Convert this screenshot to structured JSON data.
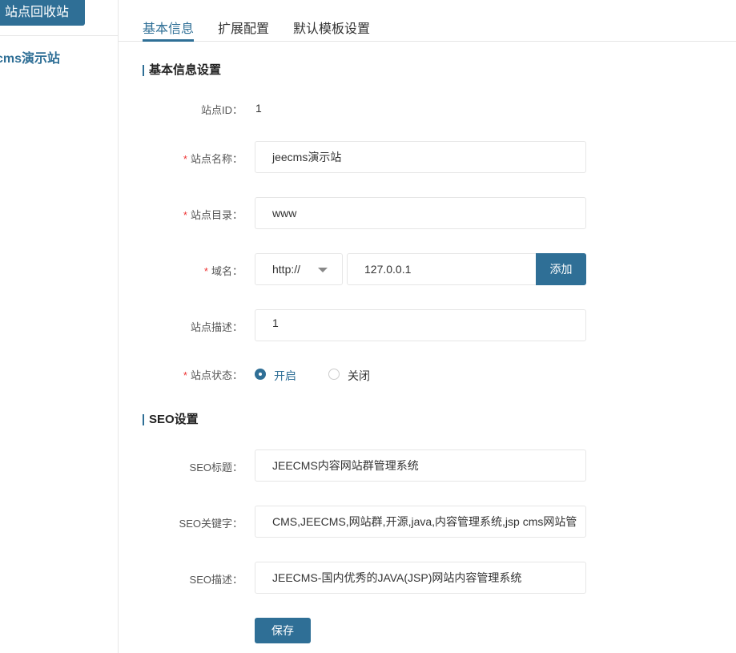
{
  "sidebar": {
    "recycle_button": "站点回收站",
    "site_item": "cms演示站"
  },
  "tabs": [
    {
      "label": "基本信息",
      "active": true
    },
    {
      "label": "扩展配置"
    },
    {
      "label": "默认模板设置"
    }
  ],
  "basic": {
    "heading": "基本信息设置",
    "site_id_label": "站点ID：",
    "site_id": "1",
    "required_mark": "*",
    "site_name_label": "站点名称：",
    "site_name": "jeecms演示站",
    "site_dir_label": "站点目录：",
    "site_dir": "www",
    "domain_label": "域名：",
    "protocol": "http://",
    "domain": "127.0.0.1",
    "add_button": "添加",
    "desc_label": "站点描述：",
    "desc": "1",
    "status_label": "站点状态：",
    "status_on": "开启",
    "status_off": "关闭",
    "status_selected": "开启"
  },
  "seo": {
    "heading": "SEO设置",
    "title_label": "SEO标题：",
    "title": "JEECMS内容网站群管理系统",
    "keywords_label": "SEO关键字：",
    "keywords": "CMS,JEECMS,网站群,开源,java,内容管理系统,jsp cms网站管",
    "desc_label": "SEO描述：",
    "desc": "JEECMS-国内优秀的JAVA(JSP)网站内容管理系统"
  },
  "save_button": "保存",
  "colors": {
    "primary": "#2f6f96",
    "required": "#ee3333"
  }
}
